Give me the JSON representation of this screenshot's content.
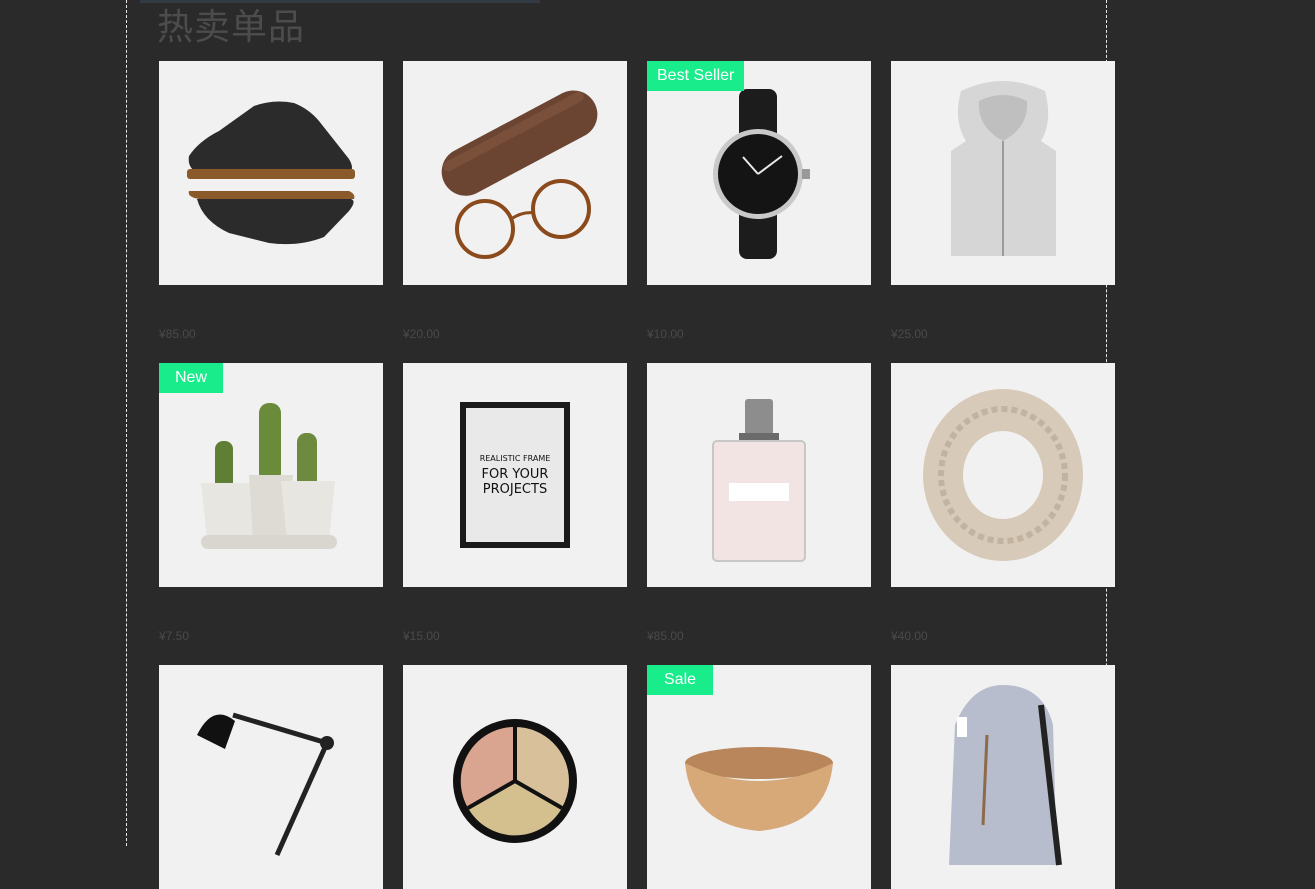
{
  "section": {
    "title": "热卖单品"
  },
  "products": [
    {
      "image": "leather-boots",
      "price": "¥85.00",
      "badge": ""
    },
    {
      "image": "glasses-and-case",
      "price": "¥20.00",
      "badge": ""
    },
    {
      "image": "wrist-watch",
      "price": "¥10.00",
      "badge": "Best Seller"
    },
    {
      "image": "grey-hoodie",
      "price": "¥25.00",
      "badge": ""
    },
    {
      "image": "cactus-pots",
      "price": "¥7.50",
      "badge": "New"
    },
    {
      "image": "picture-frame",
      "price": "¥15.00",
      "badge": "",
      "frame_text": [
        "REALISTIC FRAME",
        "FOR YOUR",
        "PROJECTS"
      ]
    },
    {
      "image": "perfume-bottle",
      "price": "¥85.00",
      "badge": ""
    },
    {
      "image": "knit-scarf",
      "price": "¥40.00",
      "badge": ""
    },
    {
      "image": "desk-lamp",
      "price": "",
      "badge": ""
    },
    {
      "image": "concealer-palette",
      "price": "",
      "badge": ""
    },
    {
      "image": "wooden-bowl",
      "price": "",
      "badge": "Sale"
    },
    {
      "image": "backpack",
      "price": "",
      "badge": ""
    }
  ],
  "colors": {
    "background": "#2a2a2a",
    "badge": "#19ec8b",
    "tile": "#f1f1f1",
    "title": "#4c4c4c"
  }
}
